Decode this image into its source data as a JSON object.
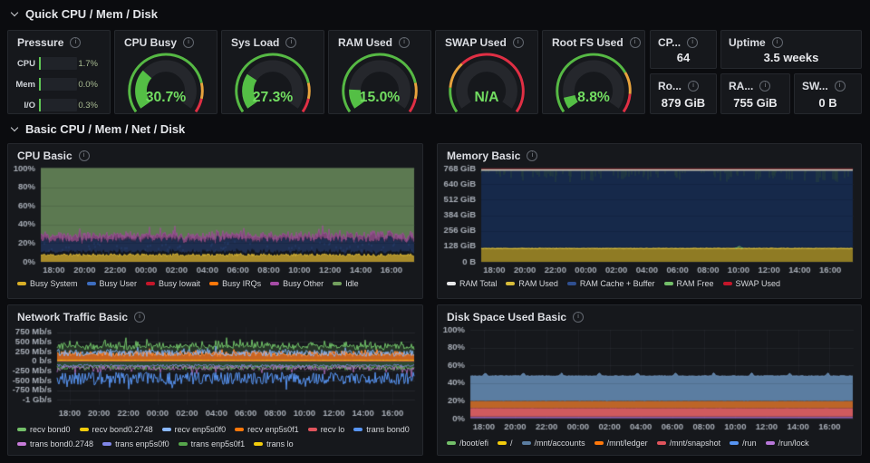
{
  "sections": [
    {
      "title": "Quick CPU / Mem / Disk"
    },
    {
      "title": "Basic CPU / Mem / Net / Disk"
    }
  ],
  "pressure": {
    "title": "Pressure",
    "rows": [
      {
        "label": "CPU",
        "value": "1.7%"
      },
      {
        "label": "Mem",
        "value": "0.0%"
      },
      {
        "label": "I/O",
        "value": "0.3%"
      }
    ]
  },
  "gauges": [
    {
      "title": "CPU Busy",
      "display": "30.7%",
      "value": 30.7,
      "thresholds": [
        [
          0.81,
          "#56b944"
        ],
        [
          0.91,
          "#e8a33d"
        ],
        [
          1,
          "#e02f44"
        ]
      ]
    },
    {
      "title": "Sys Load",
      "display": "27.3%",
      "value": 27.3,
      "thresholds": [
        [
          0.81,
          "#56b944"
        ],
        [
          0.91,
          "#e8a33d"
        ],
        [
          1,
          "#e02f44"
        ]
      ]
    },
    {
      "title": "RAM Used",
      "display": "15.0%",
      "value": 15.0,
      "thresholds": [
        [
          0.81,
          "#56b944"
        ],
        [
          0.91,
          "#e8a33d"
        ],
        [
          1,
          "#e02f44"
        ]
      ]
    },
    {
      "title": "SWAP Used",
      "display": "N/A",
      "value": 0,
      "thresholds": [
        [
          0.16,
          "#56b944"
        ],
        [
          0.33,
          "#e8a33d"
        ],
        [
          1,
          "#e02f44"
        ]
      ]
    },
    {
      "title": "Root FS Used",
      "display": "8.8%",
      "value": 8.8,
      "thresholds": [
        [
          0.74,
          "#56b944"
        ],
        [
          0.88,
          "#e8a33d"
        ],
        [
          1,
          "#e02f44"
        ]
      ]
    }
  ],
  "stats": [
    {
      "title": "CP...",
      "value": "64"
    },
    {
      "title": "Uptime",
      "value": "3.5 weeks"
    },
    {
      "title": "Ro...",
      "value": "879 GiB"
    },
    {
      "title": "RA...",
      "value": "755 GiB"
    },
    {
      "title": "SW...",
      "value": "0 B"
    }
  ],
  "chart_data": [
    {
      "id": "cpu",
      "type": "area",
      "title": "CPU Basic",
      "stacked": true,
      "ylim": [
        0,
        100
      ],
      "y_ticks": [
        "100%",
        "80%",
        "60%",
        "40%",
        "20%",
        "0%"
      ],
      "x_ticks": [
        "18:00",
        "20:00",
        "22:00",
        "00:00",
        "02:00",
        "04:00",
        "06:00",
        "08:00",
        "10:00",
        "12:00",
        "14:00",
        "16:00"
      ],
      "series": [
        {
          "name": "Busy System",
          "color": "#d9af27",
          "avg": 7
        },
        {
          "name": "Busy User",
          "color": "#3d6dbf",
          "avg": 16
        },
        {
          "name": "Busy Iowait",
          "color": "#c4162a",
          "avg": 0
        },
        {
          "name": "Busy IRQs",
          "color": "#ff780a",
          "avg": 0
        },
        {
          "name": "Busy Other",
          "color": "#a64ca6",
          "avg": 4
        },
        {
          "name": "Idle",
          "color": "#73a05e",
          "avg": 73
        }
      ]
    },
    {
      "id": "mem",
      "type": "area",
      "title": "Memory Basic",
      "unit": "GiB",
      "ylim": [
        0,
        768
      ],
      "y_ticks": [
        "768 GiB",
        "640 GiB",
        "512 GiB",
        "384 GiB",
        "256 GiB",
        "128 GiB",
        "0 B"
      ],
      "x_ticks": [
        "18:00",
        "20:00",
        "22:00",
        "00:00",
        "02:00",
        "04:00",
        "06:00",
        "08:00",
        "10:00",
        "12:00",
        "14:00",
        "16:00"
      ],
      "series": [
        {
          "name": "RAM Total",
          "color": "#e8e8ea",
          "avg": 755
        },
        {
          "name": "RAM Used",
          "color": "#d9bd3a",
          "avg": 110
        },
        {
          "name": "RAM Cache + Buffer",
          "color": "#2f4f90",
          "avg": 640
        },
        {
          "name": "RAM Free",
          "color": "#73bf69",
          "avg": 8
        },
        {
          "name": "SWAP Used",
          "color": "#c4162a",
          "avg": 0
        }
      ]
    },
    {
      "id": "net",
      "type": "line",
      "title": "Network Traffic Basic",
      "unit": "Mb/s",
      "ylim": [
        -1000,
        750
      ],
      "y_ticks": [
        "750 Mb/s",
        "500 Mb/s",
        "250 Mb/s",
        "0 b/s",
        "-250 Mb/s",
        "-500 Mb/s",
        "-750 Mb/s",
        "-1 Gb/s"
      ],
      "x_ticks": [
        "18:00",
        "20:00",
        "22:00",
        "00:00",
        "02:00",
        "04:00",
        "06:00",
        "08:00",
        "10:00",
        "12:00",
        "14:00",
        "16:00"
      ],
      "series": [
        {
          "name": "recv bond0",
          "color": "#73bf69",
          "avg": 380
        },
        {
          "name": "recv bond0.2748",
          "color": "#f2cc0c",
          "avg": 20
        },
        {
          "name": "recv enp5s0f0",
          "color": "#8ab8ff",
          "avg": 200
        },
        {
          "name": "recv enp5s0f1",
          "color": "#ff780a",
          "avg": 180
        },
        {
          "name": "recv lo",
          "color": "#e0545c",
          "avg": 2
        },
        {
          "name": "trans bond0",
          "color": "#5794f2",
          "avg": -480
        },
        {
          "name": "trans bond0.2748",
          "color": "#c77bd9",
          "avg": -200
        },
        {
          "name": "trans enp5s0f0",
          "color": "#8087e8",
          "avg": -110
        },
        {
          "name": "trans enp5s0f1",
          "color": "#56a64b",
          "avg": -150
        },
        {
          "name": "trans lo",
          "color": "#f2cc0c",
          "avg": -2
        }
      ]
    },
    {
      "id": "disk",
      "type": "area",
      "title": "Disk Space Used Basic",
      "ylim": [
        0,
        100
      ],
      "y_ticks": [
        "100%",
        "80%",
        "60%",
        "40%",
        "20%",
        "0%"
      ],
      "x_ticks": [
        "18:00",
        "20:00",
        "22:00",
        "00:00",
        "02:00",
        "04:00",
        "06:00",
        "08:00",
        "10:00",
        "12:00",
        "14:00",
        "16:00"
      ],
      "series": [
        {
          "name": "/boot/efi",
          "color": "#73bf69",
          "avg": 0.3
        },
        {
          "name": "/",
          "color": "#f2cc0c",
          "avg": 0.5
        },
        {
          "name": "/mnt/accounts",
          "color": "#5b7da1",
          "avg": 48
        },
        {
          "name": "/mnt/ledger",
          "color": "#ff780a",
          "avg": 19.5
        },
        {
          "name": "/mnt/snapshot",
          "color": "#e0545c",
          "avg": 11.5
        },
        {
          "name": "/run",
          "color": "#5794f2",
          "avg": 0.2
        },
        {
          "name": "/run/lock",
          "color": "#b877d9",
          "avg": 1.2
        }
      ]
    }
  ]
}
